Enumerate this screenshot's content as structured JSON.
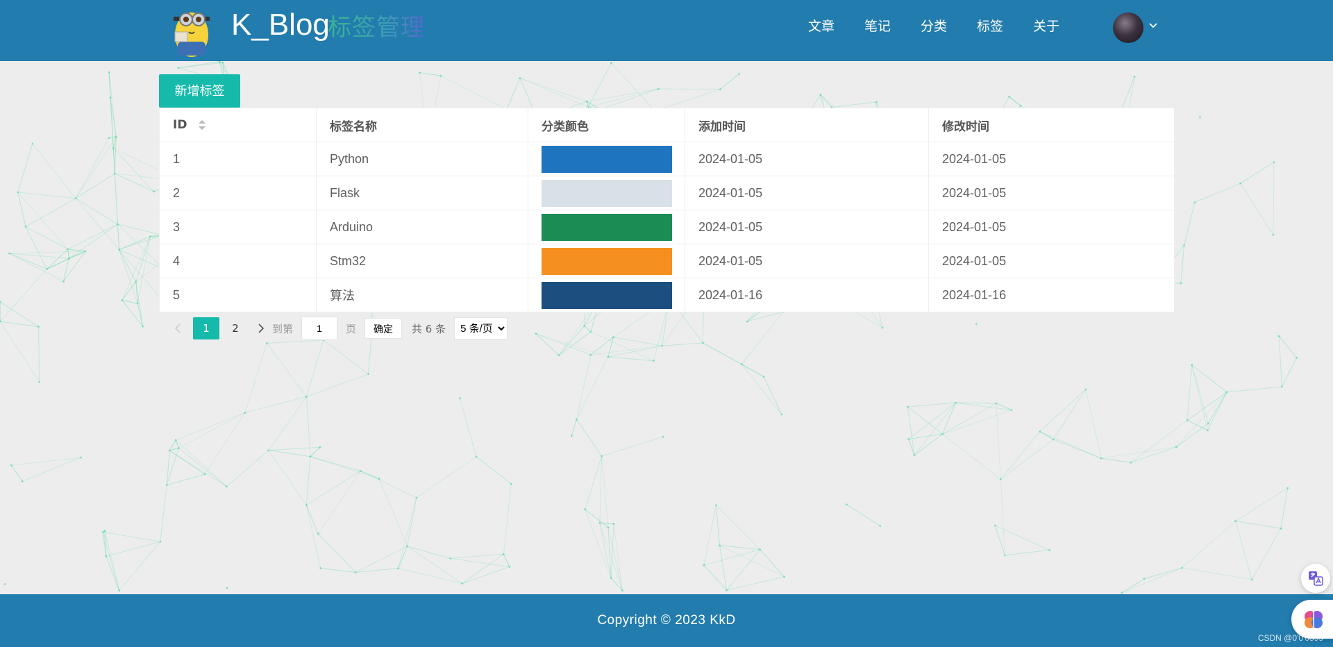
{
  "header": {
    "brand": "K_Blog",
    "page_title": "标签管理",
    "nav": [
      {
        "label": "文章"
      },
      {
        "label": "笔记"
      },
      {
        "label": "分类"
      },
      {
        "label": "标签"
      },
      {
        "label": "关于"
      }
    ],
    "avatar_icon": "user-avatar",
    "caret_icon": "chevron-down-icon"
  },
  "toolbar": {
    "add_label": "新增标签"
  },
  "table": {
    "columns": [
      "ID",
      "标签名称",
      "分类颜色",
      "添加时间",
      "修改时间"
    ],
    "rows": [
      {
        "id": "1",
        "name": "Python",
        "color": "#1f74bf",
        "created": "2024-01-05",
        "modified": "2024-01-05"
      },
      {
        "id": "2",
        "name": "Flask",
        "color": "#d8e0e8",
        "created": "2024-01-05",
        "modified": "2024-01-05"
      },
      {
        "id": "3",
        "name": "Arduino",
        "color": "#1b8c54",
        "created": "2024-01-05",
        "modified": "2024-01-05"
      },
      {
        "id": "4",
        "name": "Stm32",
        "color": "#f59020",
        "created": "2024-01-05",
        "modified": "2024-01-05"
      },
      {
        "id": "5",
        "name": "算法",
        "color": "#1c4f80",
        "created": "2024-01-16",
        "modified": "2024-01-16"
      }
    ]
  },
  "pagination": {
    "pages": [
      "1",
      "2"
    ],
    "current": "1",
    "goto_label": "到第",
    "goto_value": "1",
    "page_unit": "页",
    "confirm_label": "确定",
    "total_label": "共 6 条",
    "page_size": "5 条/页"
  },
  "footer": {
    "copyright": "Copyright  ©  2023  KkD",
    "watermark": "CSDN @0'0'0599"
  },
  "colors": {
    "header_bg": "#227cae",
    "accent": "#16baaa",
    "network_lines": "#4fd69c"
  }
}
